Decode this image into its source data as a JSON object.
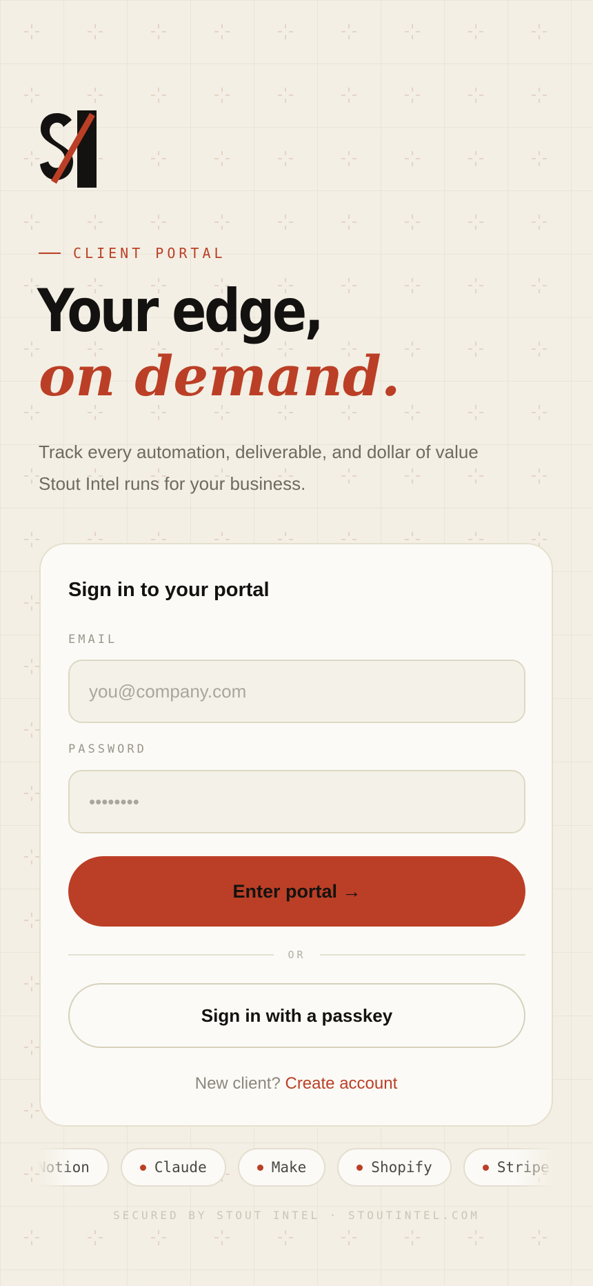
{
  "brand": {
    "logo_letters": "SI",
    "accent_color": "#bb3f26"
  },
  "hero": {
    "eyebrow": "CLIENT PORTAL",
    "headline_line1": "Your edge,",
    "headline_line2": "on demand.",
    "lede": "Track every automation, deliverable, and dollar of value Stout Intel runs for your business."
  },
  "signin_card": {
    "title": "Sign in to your portal",
    "email_label": "EMAIL",
    "email_placeholder": "you@company.com",
    "password_label": "PASSWORD",
    "password_placeholder": "••••••••",
    "submit_label": "Enter portal →",
    "divider_label": "OR",
    "passkey_label": "Sign in with a passkey",
    "signup_prompt": "New client?",
    "signup_link": "Create account"
  },
  "integrations": [
    "Notion",
    "Claude",
    "Make",
    "Shopify",
    "Stripe"
  ],
  "footer": {
    "text": "SECURED BY STOUT INTEL · STOUTINTEL.COM"
  },
  "icons": {
    "grid_marker": "plus-marker-icon"
  }
}
